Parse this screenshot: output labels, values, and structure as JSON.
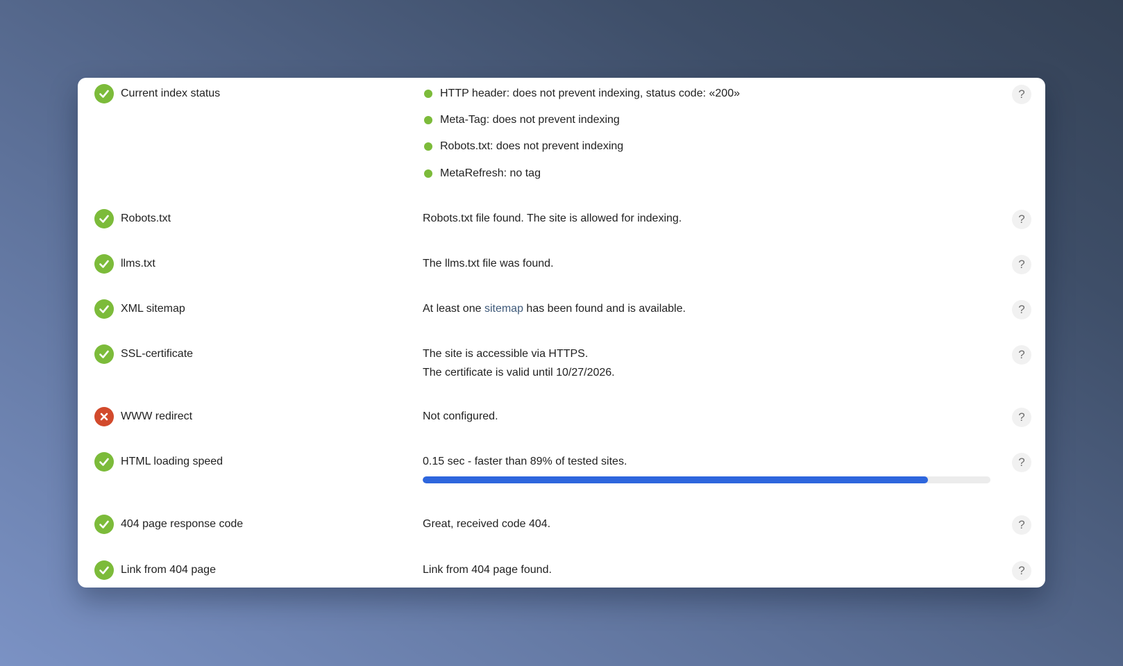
{
  "rows": [
    {
      "label": "Current index status",
      "status": "ok",
      "bullets": [
        "HTTP header: does not prevent indexing, status code: «200»",
        "Meta-Tag: does not prevent indexing",
        "Robots.txt: does not prevent indexing",
        "MetaRefresh: no tag"
      ]
    },
    {
      "label": "Robots.txt",
      "status": "ok",
      "text": "Robots.txt file found. The site is allowed for indexing."
    },
    {
      "label": "llms.txt",
      "status": "ok",
      "text": "The llms.txt file was found."
    },
    {
      "label": "XML sitemap",
      "status": "ok",
      "text_before": "At least one ",
      "link": "sitemap",
      "text_after": " has been found and is available."
    },
    {
      "label": "SSL-certificate",
      "status": "ok",
      "text": "The site is accessible via HTTPS.",
      "text2": "The certificate is valid until 10/27/2026."
    },
    {
      "label": "WWW redirect",
      "status": "fail",
      "text": "Not configured."
    },
    {
      "label": "HTML loading speed",
      "status": "ok",
      "text": "0.15 sec - faster than 89% of tested sites.",
      "progress_percent": 89
    },
    {
      "label": "404 page response code",
      "status": "ok",
      "text": "Great, received code 404."
    },
    {
      "label": "Link from 404 page",
      "status": "ok",
      "text": "Link from 404 page found."
    }
  ],
  "help_glyph": "?",
  "colors": {
    "ok": "#7cbb3a",
    "fail": "#d24a2c",
    "progress": "#2e66dd",
    "link": "#3f5a7a"
  },
  "icons": {
    "ok": "check-circle-icon",
    "fail": "x-circle-icon",
    "help": "question-icon",
    "bullet": "green-dot-icon"
  }
}
